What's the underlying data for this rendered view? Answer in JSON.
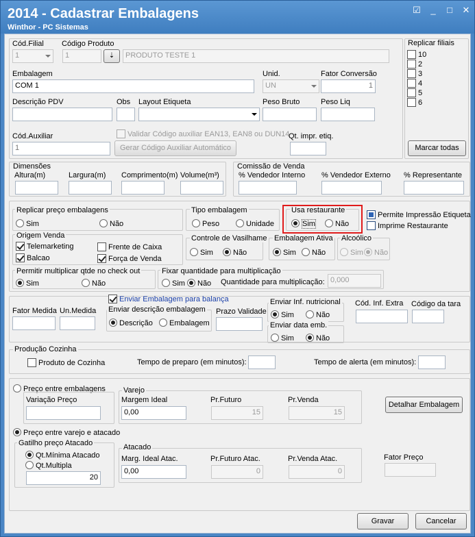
{
  "window": {
    "title": "2014 - Cadastrar Embalagens",
    "subtitle": "Winthor - PC Sistemas",
    "controls": [
      "☑",
      "_",
      "□",
      "✕"
    ]
  },
  "top": {
    "cod_filial_label": "Cód.Filial",
    "cod_filial_value": "1",
    "cod_produto_label": "Código Produto",
    "cod_produto_value": "1",
    "produto_desc": "PRODUTO TESTE 1",
    "embalagem_label": "Embalagem",
    "embalagem_value": "COM 1",
    "unid_label": "Unid.",
    "unid_value": "UN",
    "fator_label": "Fator Conversão",
    "fator_value": "1",
    "desc_pdv_label": "Descrição PDV",
    "obs_label": "Obs",
    "layout_label": "Layout Etiqueta",
    "peso_bruto_label": "Peso Bruto",
    "peso_liq_label": "Peso Liq",
    "cod_aux_label": "Cód.Auxiliar",
    "cod_aux_value": "1",
    "validar_label": "Validar Código auxiliar EAN13, EAN8 ou DUN14",
    "gerar_label": "Gerar Código Auxiliar Automático",
    "qt_impr_label": "Qt. impr. etiq."
  },
  "replicar_filiais": {
    "title": "Replicar filiais",
    "items": [
      "10",
      "2",
      "3",
      "4",
      "5",
      "6"
    ],
    "button": "Marcar todas"
  },
  "dimensoes": {
    "title": "Dimensões",
    "altura": "Altura(m)",
    "largura": "Largura(m)",
    "comprimento": "Comprimento(m)",
    "volume": "Volume(m³)"
  },
  "comissao": {
    "title": "Comissão de Venda",
    "interno": "% Vendedor Interno",
    "externo": "% Vendedor Externo",
    "representante": "% Representante"
  },
  "replicar_preco": {
    "title": "Replicar preço embalagens",
    "sim": "Sim",
    "nao": "Não"
  },
  "tipo_embalagem": {
    "title": "Tipo embalagem",
    "peso": "Peso",
    "unidade": "Unidade"
  },
  "usa_restaurante": {
    "title": "Usa restaurante",
    "sim": "Sim",
    "nao": "Não"
  },
  "permite_impressao": "Permite Impressão Etiqueta",
  "imprime_restaurante": "Imprime Restaurante",
  "origem_venda": {
    "title": "Origem Venda",
    "telemarketing": "Telemarketing",
    "balcao": "Balcao",
    "frente_caixa": "Frente de Caixa",
    "forca_venda": "Força de Venda"
  },
  "vasilhame": {
    "title": "Controle de Vasilhame",
    "sim": "Sim",
    "nao": "Não"
  },
  "ativa": {
    "title": "Embalagem Ativa",
    "sim": "Sim",
    "nao": "Não"
  },
  "alcoolico": {
    "title": "Alcoólico",
    "sim": "Sim",
    "nao": "Não"
  },
  "permitir_mult": {
    "title": "Permitir multiplicar qtde no check out",
    "sim": "Sim",
    "nao": "Não"
  },
  "fixar_qtd": {
    "title": "Fixar quantidade para multiplicação",
    "sim": "Sim",
    "nao": "Não",
    "qtd_label": "Quantidade para multiplicação:",
    "qtd_value": "0,000"
  },
  "balanca": {
    "fator_medida": "Fator Medida",
    "un_medida": "Un.Medida",
    "enviar_balanca": "Enviar Embalagem para balança",
    "enviar_desc": "Enviar descrição embalagem",
    "descricao": "Descrição",
    "embalagem": "Embalagem",
    "prazo": "Prazo Validade",
    "inf_nutri": "Enviar Inf. nutricional",
    "sim": "Sim",
    "nao": "Não",
    "data_emb": "Enviar data emb.",
    "cod_inf_extra": "Cód. Inf. Extra",
    "cod_tara": "Código da tara"
  },
  "producao": {
    "title": "Produção Cozinha",
    "produto_cozinha": "Produto de Cozinha",
    "tempo_preparo": "Tempo de preparo (em minutos):",
    "tempo_alerta": "Tempo de alerta (em minutos):"
  },
  "preco_entre": {
    "title": "Preço entre embalagens",
    "variacao": "Variação Preço",
    "varejo": "Varejo",
    "margem_ideal": "Margem Ideal",
    "margem_value": "0,00",
    "pr_futuro": "Pr.Futuro",
    "pr_futuro_value": "15",
    "pr_venda": "Pr.Venda",
    "pr_venda_value": "15",
    "detalhar": "Detalhar Embalagem"
  },
  "preco_varejo": {
    "title": "Preço entre varejo e atacado",
    "gatilho": "Gatilho preço Atacado",
    "qt_minima": "Qt.Mínima Atacado",
    "qt_multipla": "Qt.Multipla",
    "gatilho_value": "20",
    "atacado": "Atacado",
    "marg_ideal": "Marg. Ideal Atac.",
    "marg_value": "0,00",
    "pr_futuro": "Pr.Futuro Atac.",
    "pr_futuro_value": "0",
    "pr_venda": "Pr.Venda Atac.",
    "pr_venda_value": "0",
    "fator_preco": "Fator Preço"
  },
  "footer": {
    "gravar": "Gravar",
    "cancelar": "Cancelar"
  }
}
